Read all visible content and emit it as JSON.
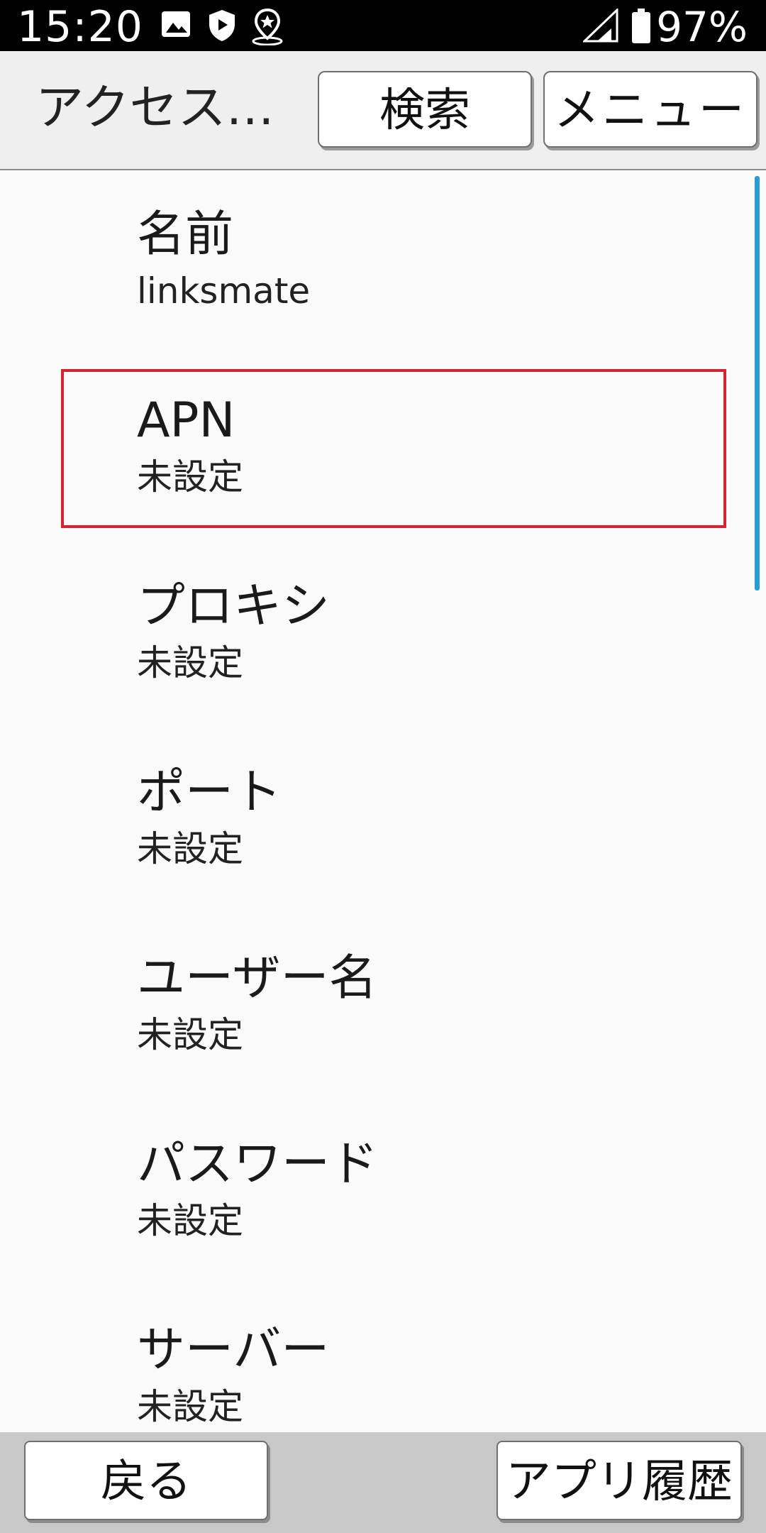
{
  "status_bar": {
    "time": "15:20",
    "battery_text": "97%",
    "icons": [
      "image-icon",
      "shield-icon",
      "location-star-icon",
      "signal-icon",
      "battery-icon"
    ]
  },
  "app_bar": {
    "title": "アクセス…",
    "search_label": "検索",
    "menu_label": "メニュー"
  },
  "settings": {
    "items": [
      {
        "title": "名前",
        "value": "linksmate"
      },
      {
        "title": "APN",
        "value": "未設定"
      },
      {
        "title": "プロキシ",
        "value": "未設定"
      },
      {
        "title": "ポート",
        "value": "未設定"
      },
      {
        "title": "ユーザー名",
        "value": "未設定"
      },
      {
        "title": "パスワード",
        "value": "未設定"
      },
      {
        "title": "サーバー",
        "value": "未設定"
      }
    ],
    "focused_index": 1
  },
  "bottom_bar": {
    "back_label": "戻る",
    "app_history_label": "アプリ履歴"
  },
  "colors": {
    "focus_border": "#d42331",
    "scrollbar": "#2a9ed3",
    "status_bar_bg": "#000000",
    "app_bar_bg": "#efefef",
    "bottom_bar_bg": "#c8c8c8"
  }
}
